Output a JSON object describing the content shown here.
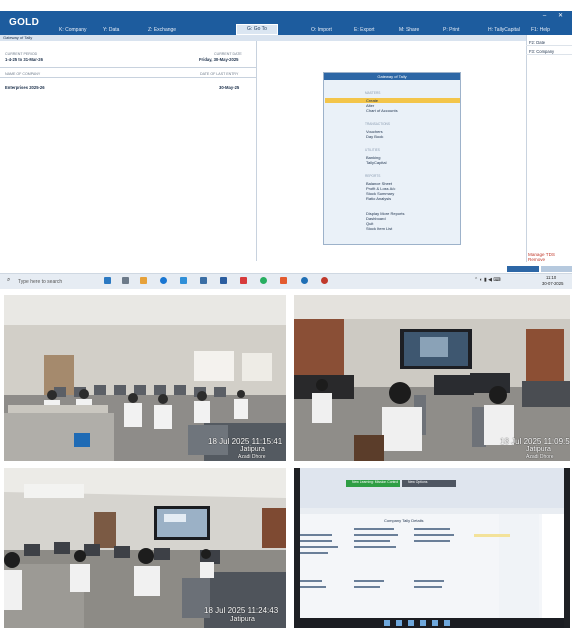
{
  "tally": {
    "product": "GOLD",
    "menu": [
      "K: Company",
      "Y: Data",
      "Z: Exchange",
      "G: Go To",
      "O: Import",
      "E: Export",
      "M: Share",
      "P: Print",
      "F1: Help"
    ],
    "tallycapital_menu": "H: TallyCapital",
    "subheader_title": "Gateway of Tally",
    "header_left": "Gateway of Tally",
    "current_period_label": "CURRENT PERIOD",
    "current_period_value": "1-4-25 to 31-Mar-26",
    "current_date_label": "CURRENT DATE",
    "current_date_value": "Friday, 30-May-2025",
    "company_name_label": "NAME OF COMPANY",
    "date_last_entry_label": "DATE OF LAST ENTRY",
    "company_name_value": "Enterprises 2025-26",
    "last_entry_value": "30-May-25",
    "gateway": {
      "title": "Gateway of Tally",
      "sections": [
        {
          "heading": "MASTERS",
          "items": [
            "Create",
            "Alter",
            "Chart of Accounts"
          ]
        },
        {
          "heading": "TRANSACTIONS",
          "items": [
            "Vouchers",
            "Day Book"
          ]
        },
        {
          "heading": "UTILITIES",
          "items": [
            "Banking",
            "TallyCapital"
          ]
        },
        {
          "heading": "REPORTS",
          "items": [
            "Balance Sheet",
            "Profit & Loss A/c",
            "Stock Summary",
            "Ratio Analysis"
          ]
        },
        {
          "heading": "",
          "items": [
            "Display More Reports",
            "Dashboard",
            "Quit",
            "Stock Item List"
          ]
        }
      ]
    },
    "right_panel": [
      "F2: Date",
      "F3: Company"
    ],
    "manage_tds": "Manage TDS Remove",
    "search_placeholder": "Type here to search",
    "clock_time": "11:10",
    "clock_date": "30-07-2025"
  },
  "photos": [
    {
      "timestamp": "18 Jul 2025 11:15:41",
      "location": "Jatipura",
      "sub": "Azadi Dhore"
    },
    {
      "timestamp": "18 Jul 2025 11:09:5",
      "location": "Jatipura",
      "sub": "Azadi Dhore"
    },
    {
      "timestamp": "18 Jul 2025 11:24:43",
      "location": "Jatipura",
      "sub": ""
    },
    {
      "title": "Company Tally Details",
      "buttons": [
        "New Learning: Mission Control",
        "New Options"
      ]
    }
  ],
  "colors": {
    "tally_blue": "#1d5c9e",
    "highlight": "#f3c54a",
    "manage_red": "#c0392b"
  }
}
